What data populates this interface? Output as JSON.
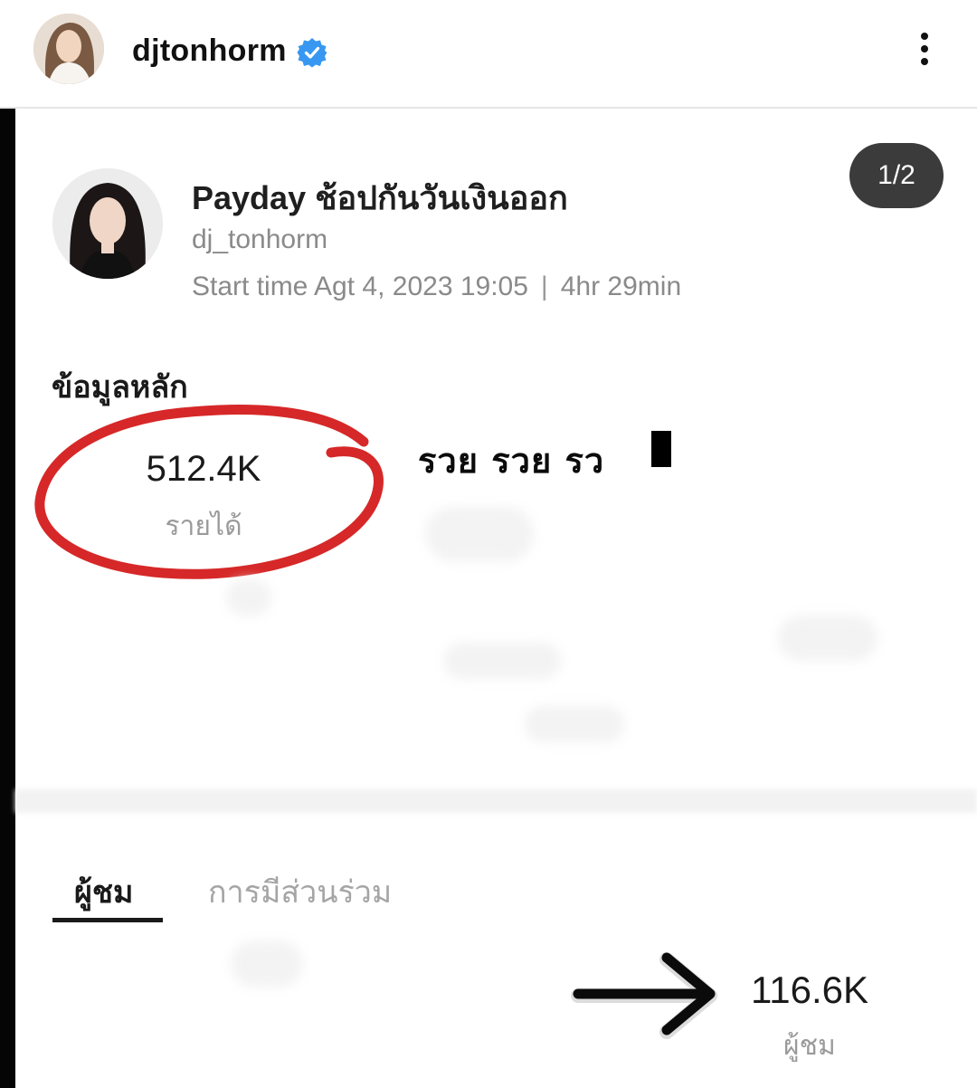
{
  "post": {
    "username": "djtonhorm",
    "counter": "1/2"
  },
  "live": {
    "title": "Payday ช้อปกันวันเงินออก",
    "handle": "dj_tonhorm",
    "start_time": "Start time Agt 4, 2023 19:05",
    "separator": "|",
    "duration": "4hr 29min"
  },
  "main": {
    "section_title": "ข้อมูลหลัก",
    "revenue_value": "512.4K",
    "revenue_label": "รายได้",
    "handwritten_text": "รวย รวย รว"
  },
  "tabs": {
    "viewers": "ผู้ชม",
    "engagement": "การมีส่วนร่วม"
  },
  "viewers": {
    "value": "116.6K",
    "label": "ผู้ชม"
  },
  "colors": {
    "verified_badge": "#3897f0",
    "annotation_red": "#d62828",
    "counter_pill": "#3b3b3b"
  }
}
